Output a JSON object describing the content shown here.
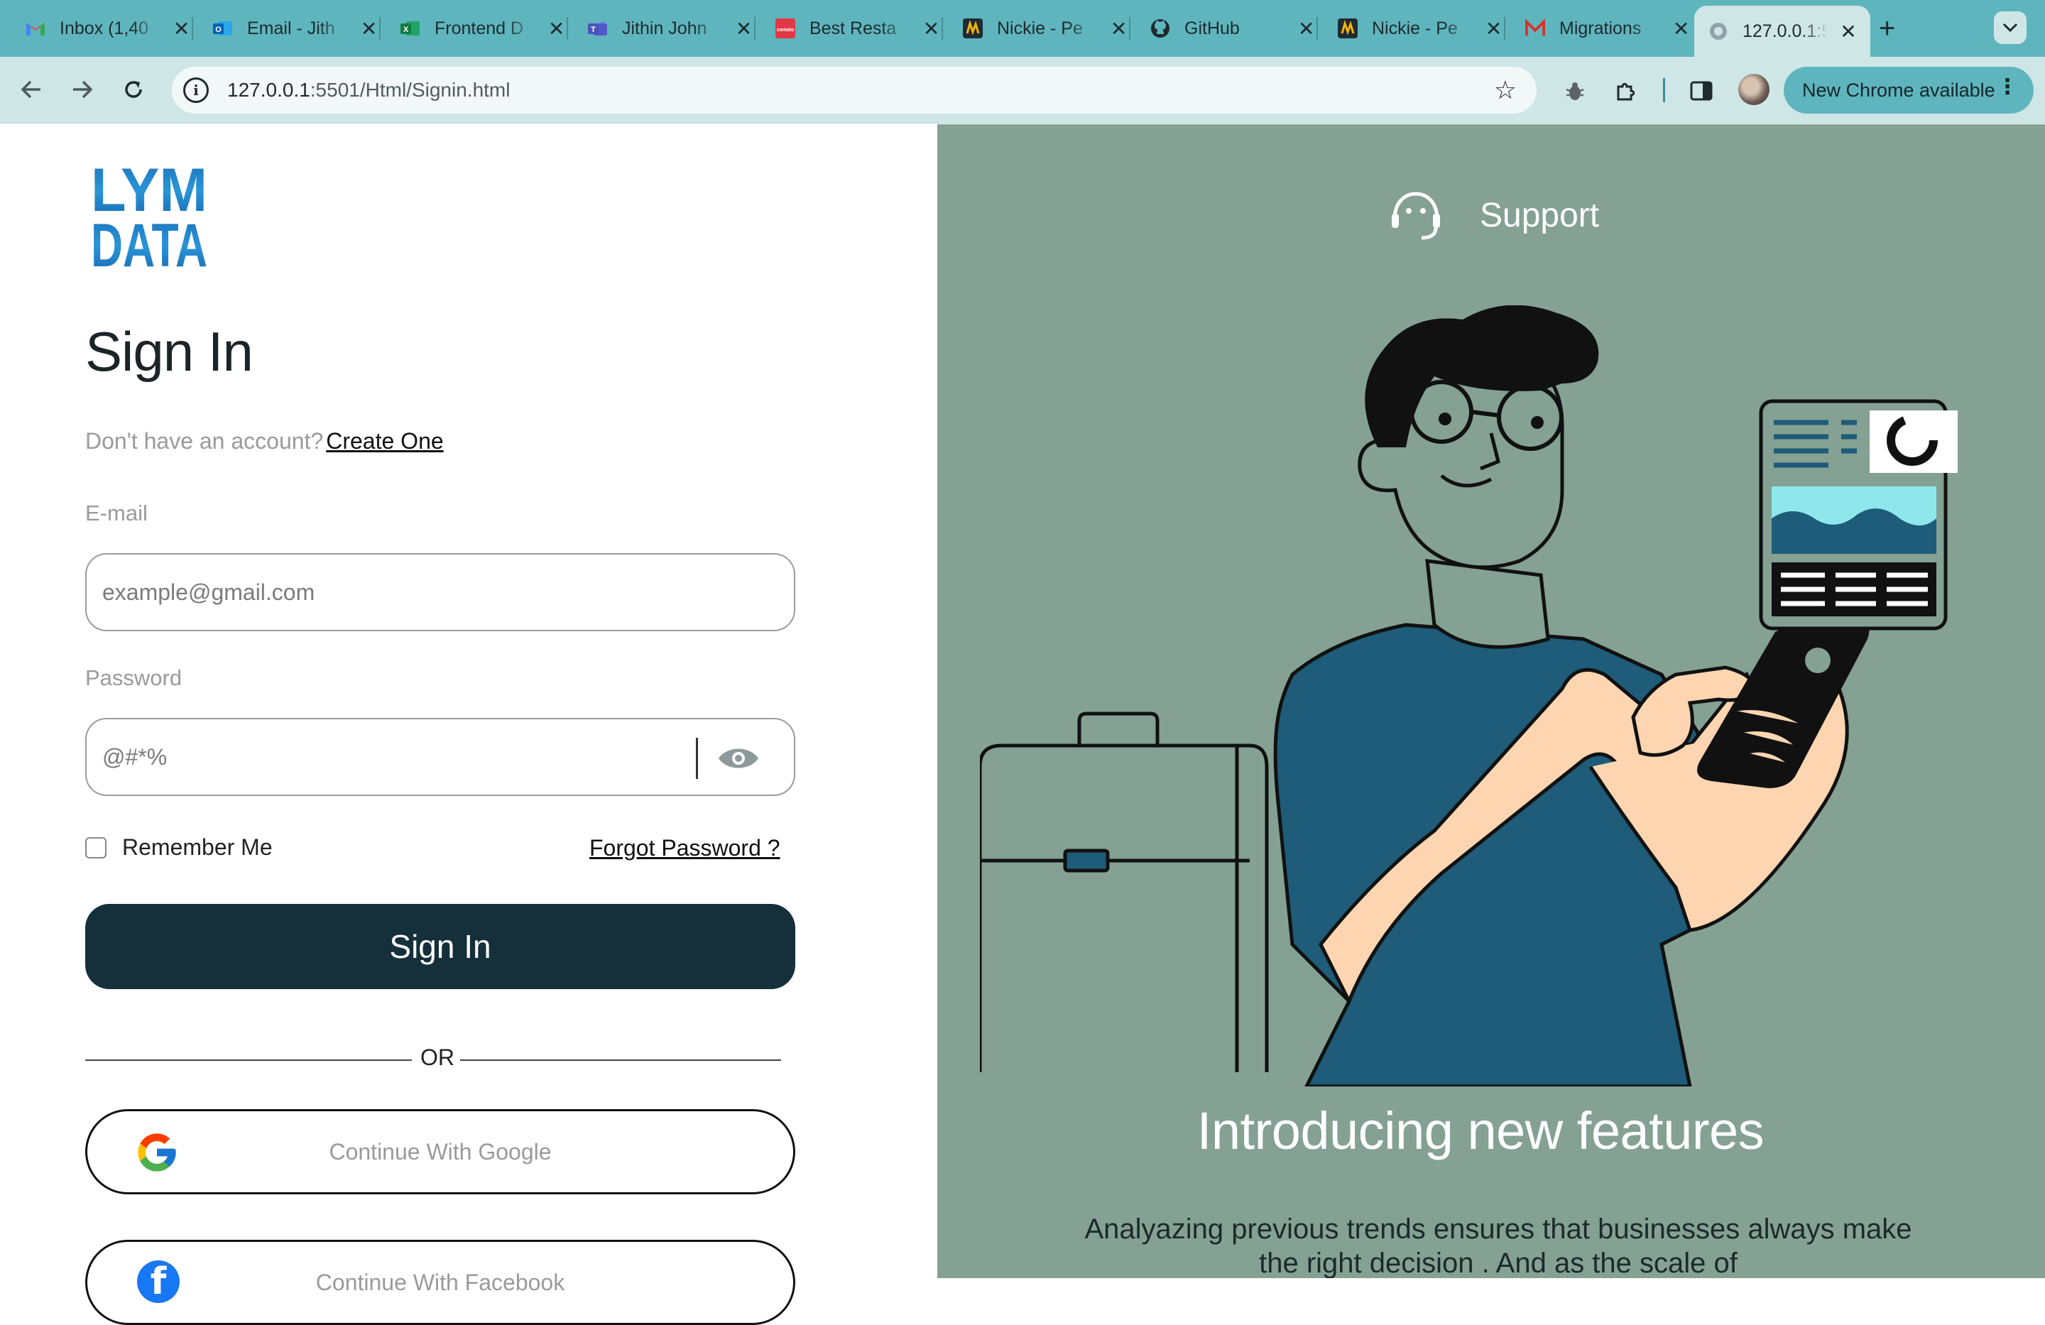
{
  "browser": {
    "tabs": [
      {
        "title": "Inbox (1,40",
        "icon": "gmail-icon"
      },
      {
        "title": "Email - Jith",
        "icon": "outlook-icon"
      },
      {
        "title": "Frontend D",
        "icon": "excel-icon"
      },
      {
        "title": "Jithin John",
        "icon": "teams-icon"
      },
      {
        "title": "Best Resta",
        "icon": "zomato-icon"
      },
      {
        "title": "Nickie - Pe",
        "icon": "nickie-icon"
      },
      {
        "title": "GitHub",
        "icon": "github-icon"
      },
      {
        "title": "Nickie - Pe",
        "icon": "nickie-icon"
      },
      {
        "title": "Migrations",
        "icon": "migrations-icon"
      },
      {
        "title": "127.0.0.1:5",
        "icon": "globe-icon",
        "active": true
      }
    ],
    "new_tab_label": "+",
    "address": {
      "host": "127.0.0.1",
      "path": ":5501/Html/Signin.html"
    },
    "update_button": "New Chrome available"
  },
  "signin": {
    "logo_text": [
      "LYM",
      "DATA"
    ],
    "title": "Sign In",
    "no_account_text": "Don't have an account?",
    "create_link": "Create One",
    "email_label": "E-mail",
    "email_placeholder": "example@gmail.com",
    "password_label": "Password",
    "password_placeholder": "@#*%",
    "remember_label": "Remember Me",
    "forgot_link": "Forgot Password ?",
    "submit_label": "Sign In",
    "or_text": "OR",
    "google_label": "Continue With Google",
    "facebook_label": "Continue With Facebook"
  },
  "promo": {
    "support_label": "Support",
    "headline": "Introducing new features",
    "description": "Analyazing previous trends ensures that businesses always make the right decision . And as the scale of"
  },
  "colors": {
    "tabstrip": "#5fb5bd",
    "toolbar": "#cfe6e7",
    "primary_button": "#152f3b",
    "promo_background": "#84a193",
    "shirt": "#1e5c79",
    "skin": "#fdd5b1"
  }
}
